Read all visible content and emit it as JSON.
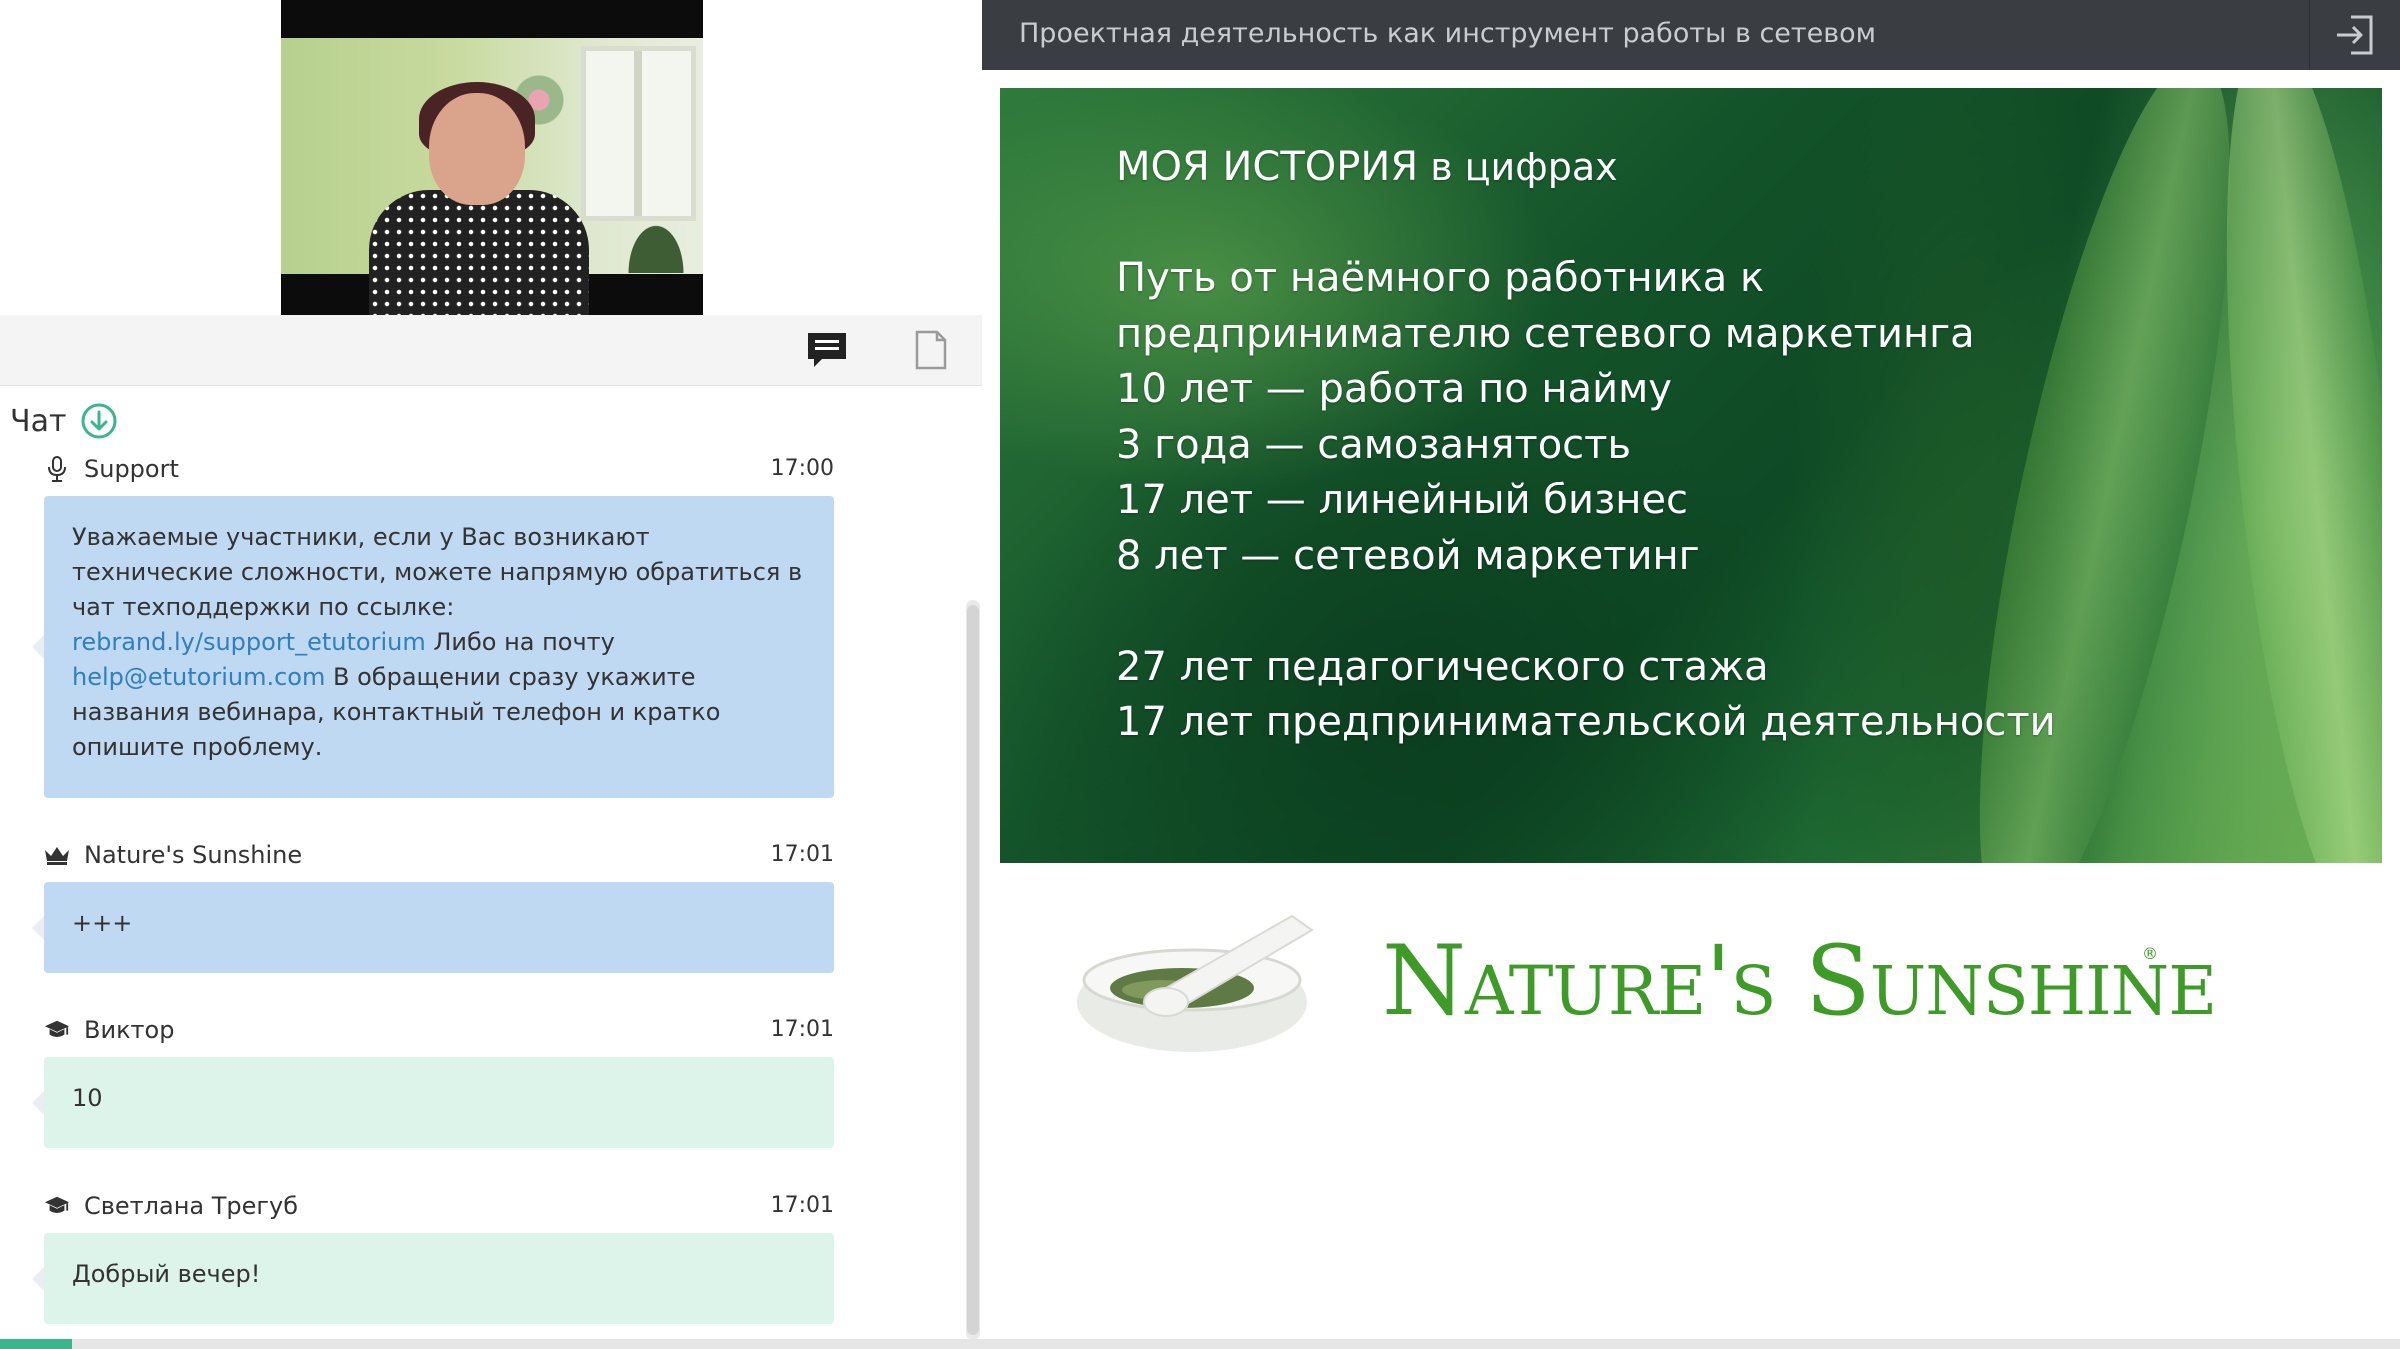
{
  "chat": {
    "title": "Чат",
    "messages": [
      {
        "author": "Support",
        "role_icon": "microphone-icon",
        "time": "17:00",
        "style": "blue",
        "text_before_link1": "Уважаемые участники, если у Вас возникают технические сложности, можете напрямую обратиться в чат техподдержки по ссылке: ",
        "link1": "rebrand.ly/support_etutorium",
        "text_between": " Либо на почту ",
        "link2": "help@etutorium.com",
        "text_after": " В обращении сразу укажите названия вебинара, контактный телефон и кратко опишите проблему."
      },
      {
        "author": "Nature's Sunshine",
        "role_icon": "crown-icon",
        "time": "17:01",
        "style": "blue",
        "text": "+++"
      },
      {
        "author": "Виктор",
        "role_icon": "graduation-cap-icon",
        "time": "17:01",
        "style": "green",
        "text": "10"
      },
      {
        "author": "Светлана Трегуб",
        "role_icon": "graduation-cap-icon",
        "time": "17:01",
        "style": "green",
        "text": "Добрый вечер!"
      }
    ]
  },
  "toolbar": {
    "chat_icon": "chat-bubble-icon",
    "files_icon": "document-icon"
  },
  "webinar": {
    "title": "Проектная деятельность как инструмент работы в сетевом"
  },
  "slide": {
    "heading_caps": "МОЯ ИСТОРИЯ",
    "heading_rest": " в цифрах",
    "lines_a": [
      "Путь от наёмного работника к",
      "предпринимателю сетевого маркетинга",
      "10 лет — работа по найму",
      "3 года — самозанятость",
      "17 лет — линейный бизнес",
      "8 лет — сетевой маркетинг"
    ],
    "lines_b": [
      "27 лет педагогического стажа",
      "17 лет предпринимательской деятельности"
    ],
    "brand": "Nature's Sunshine",
    "brand_mark": "®"
  },
  "progress": {
    "fraction": 0.03
  },
  "colors": {
    "accent": "#3bb58b",
    "brand_green": "#3f9b28",
    "bubble_blue": "#bfd9f2",
    "bubble_green": "#ddf4ea",
    "topbar": "#3a3d42"
  }
}
